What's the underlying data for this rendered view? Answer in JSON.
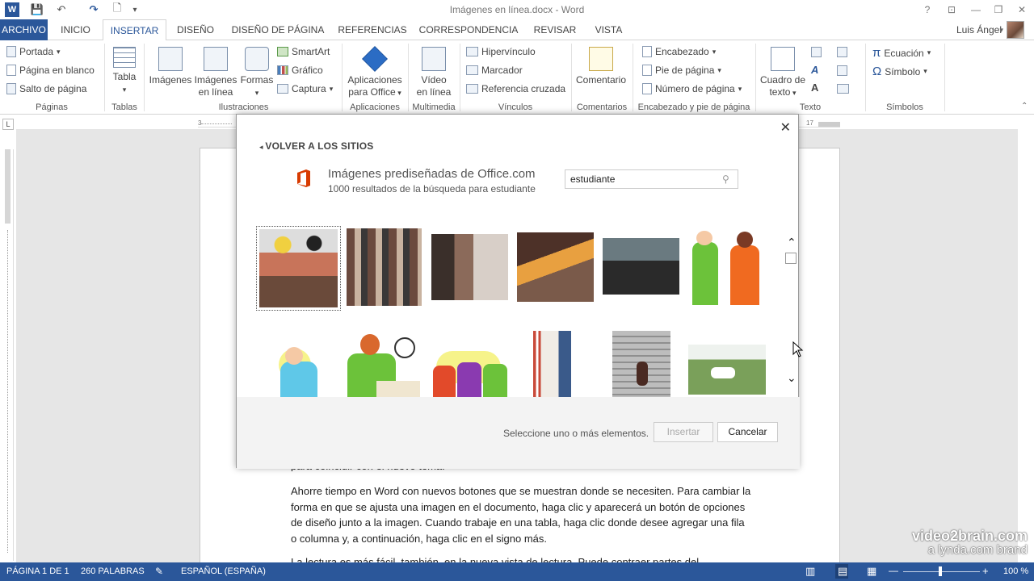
{
  "window": {
    "title": "Imágenes en línea.docx - Word",
    "controls": [
      "?",
      "⊡",
      "—",
      "❐",
      "✕"
    ]
  },
  "qat": {
    "word_icon": "W",
    "save_icon": "💾",
    "undo_icon": "↶",
    "redo_icon": "↷",
    "new_icon": "🗋",
    "more_icon": "▾"
  },
  "tabs": [
    "ARCHIVO",
    "INICIO",
    "INSERTAR",
    "DISEÑO",
    "DISEÑO DE PÁGINA",
    "REFERENCIAS",
    "CORRESPONDENCIA",
    "REVISAR",
    "VISTA"
  ],
  "user": {
    "name": "Luis Ángel"
  },
  "ribbon": {
    "paginas": {
      "label": "Páginas",
      "portada": "Portada",
      "en_blanco": "Página en blanco",
      "salto": "Salto de página"
    },
    "tablas": {
      "label": "Tablas",
      "tabla": "Tabla"
    },
    "ilustraciones": {
      "label": "Ilustraciones",
      "imagenes": "Imágenes",
      "en_linea_1": "Imágenes",
      "en_linea_2": "en línea",
      "formas": "Formas",
      "smartart": "SmartArt",
      "grafico": "Gráfico",
      "captura": "Captura"
    },
    "aplicaciones": {
      "label": "Aplicaciones",
      "line1": "Aplicaciones",
      "line2": "para Office"
    },
    "multimedia": {
      "label": "Multimedia",
      "line1": "Vídeo",
      "line2": "en línea"
    },
    "vinculos": {
      "label": "Vínculos",
      "hipervinculo": "Hipervínculo",
      "marcador": "Marcador",
      "referencia": "Referencia cruzada"
    },
    "comentarios": {
      "label": "Comentarios",
      "comentario": "Comentario"
    },
    "encabezado": {
      "label": "Encabezado y pie de página",
      "encabezado": "Encabezado",
      "pie": "Pie de página",
      "numero": "Número de página"
    },
    "texto": {
      "label": "Texto",
      "cuadro_1": "Cuadro de",
      "cuadro_2": "texto"
    },
    "simbolos": {
      "label": "Símbolos",
      "ecuacion": "Ecuación",
      "simbolo": "Símbolo"
    }
  },
  "ruler": {
    "left_num": "3",
    "right_num": "17"
  },
  "dialog": {
    "back": "VOLVER A LOS SITIOS",
    "source_title": "Imágenes prediseñadas de Office.com",
    "source_sub": "1000 resultados de la búsqueda para estudiante",
    "search_value": "estudiante",
    "status_msg": "Seleccione uno o más elementos.",
    "insert": "Insertar",
    "cancel": "Cancelar"
  },
  "document": {
    "partial_line": "para coincidir con el nuevo tema.",
    "para1": "Ahorre tiempo en Word con nuevos botones que se muestran donde se necesiten. Para cambiar la forma en que se ajusta una imagen en el documento, haga clic y aparecerá un botón de opciones de diseño junto a la imagen. Cuando trabaje en una tabla, haga clic donde desee agregar una fila o columna y, a continuación, haga clic en el signo más.",
    "para2_partial": "La lectura es más fácil, también, en la nueva vista de lectura. Puede contraer partes del"
  },
  "statusbar": {
    "page": "PÁGINA 1 DE 1",
    "words": "260 PALABRAS",
    "lang": "ESPAÑOL (ESPAÑA)",
    "zoom": "100 %"
  },
  "watermark": {
    "line1": "video2brain.com",
    "line2": "a lynda.com brand"
  }
}
